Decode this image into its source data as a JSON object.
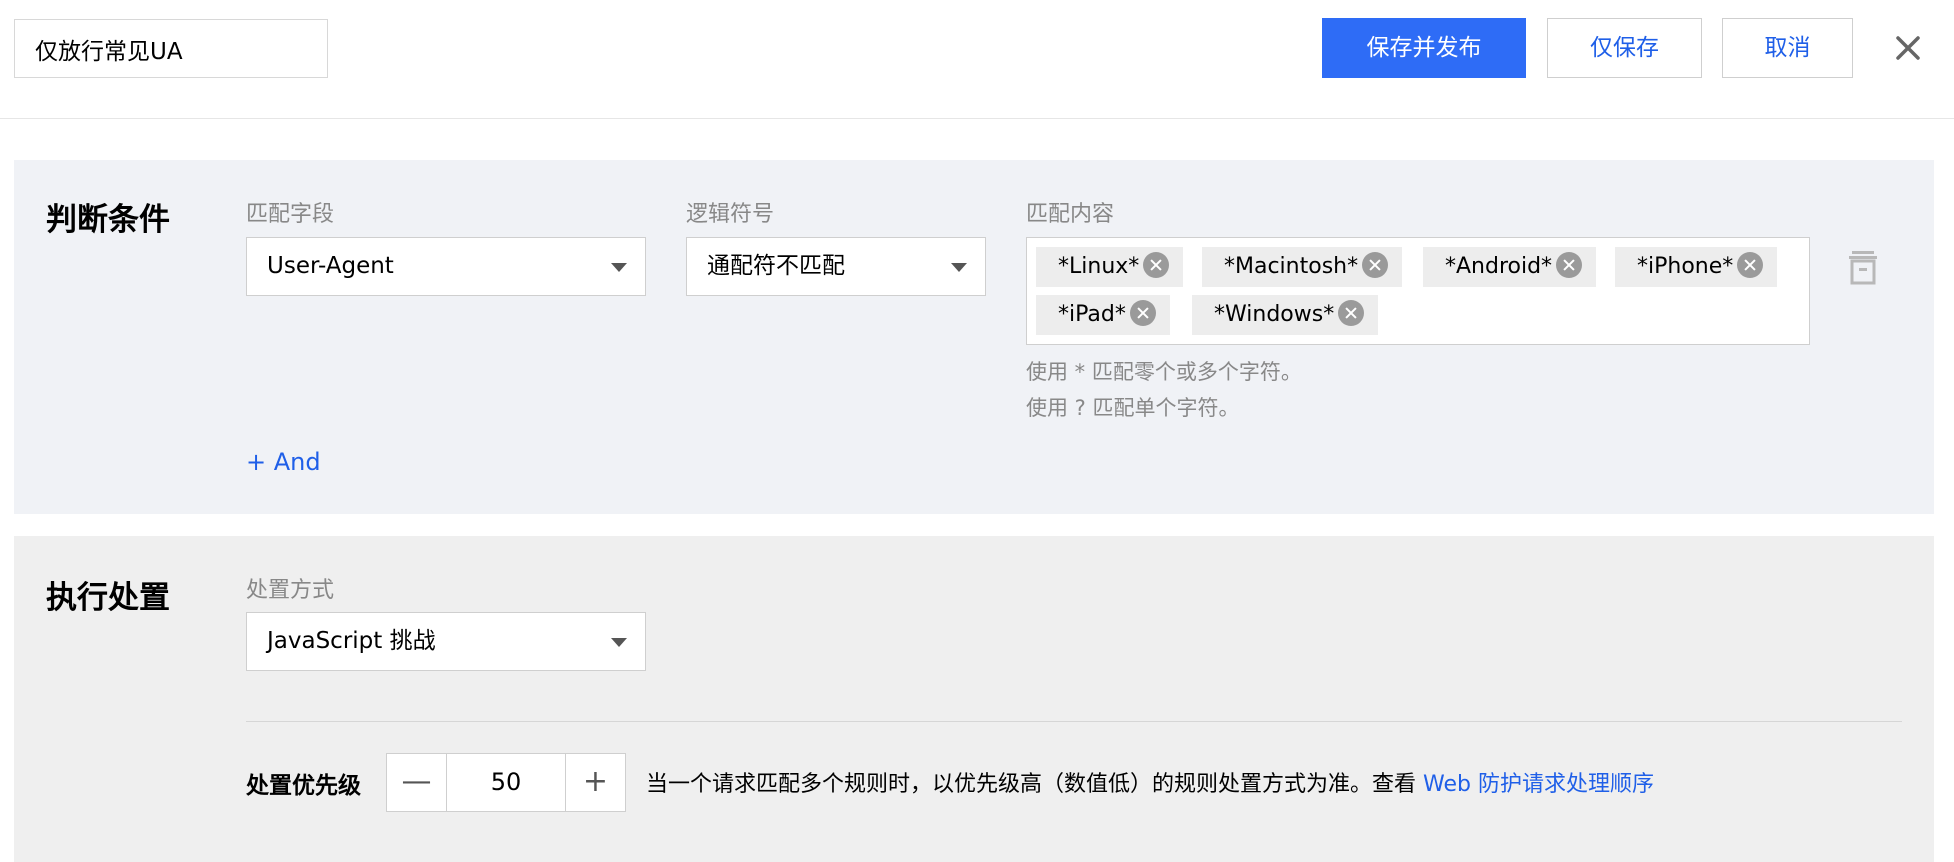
{
  "header": {
    "rule_name": "仅放行常见UA",
    "save_publish_label": "保存并发布",
    "save_only_label": "仅保存",
    "cancel_label": "取消"
  },
  "condition": {
    "title": "判断条件",
    "match_field_label": "匹配字段",
    "match_field_value": "User-Agent",
    "operator_label": "逻辑符号",
    "operator_value": "通配符不匹配",
    "content_label": "匹配内容",
    "tags": [
      "*Linux*",
      "*Macintosh*",
      "*Android*",
      "*iPhone*",
      "*iPad*",
      "*Windows*"
    ],
    "hint_1": "使用 * 匹配零个或多个字符。",
    "hint_2": "使用 ? 匹配单个字符。",
    "add_and_label": "+ And"
  },
  "action": {
    "title": "执行处置",
    "method_label": "处置方式",
    "method_value": "JavaScript 挑战",
    "priority_label": "处置优先级",
    "priority_value": "50",
    "priority_desc": "当一个请求匹配多个规则时，以优先级高（数值低）的规则处置方式为准。查看",
    "priority_link": "Web 防护请求处理顺序"
  },
  "colors": {
    "primary": "#2e6cf6",
    "link": "#1f5fe8",
    "condition_bg": "#f0f2f6",
    "action_bg": "#efefef"
  }
}
